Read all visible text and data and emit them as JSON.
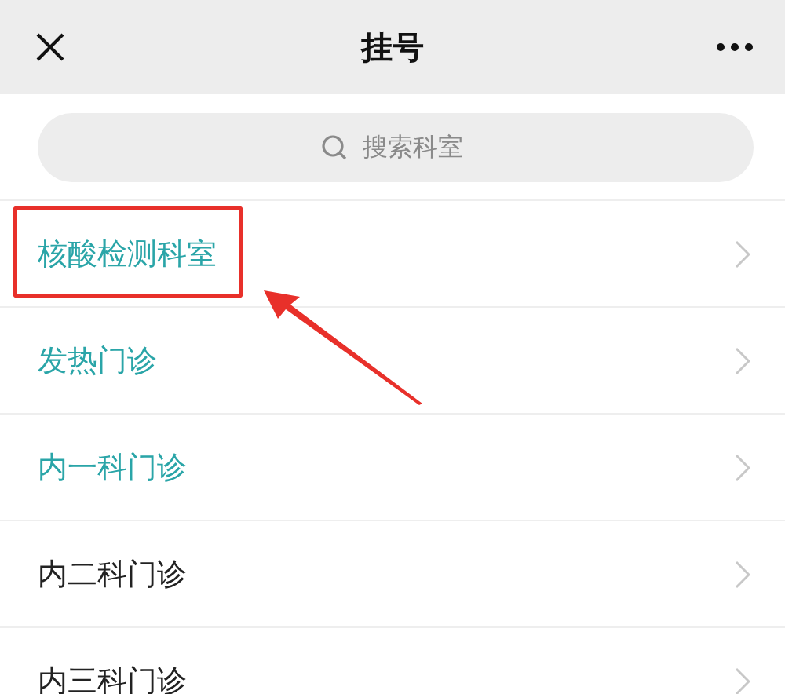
{
  "header": {
    "title": "挂号"
  },
  "search": {
    "placeholder": "搜索科室"
  },
  "departments": [
    {
      "name": "核酸检测科室",
      "color": "#2aa5a8",
      "marked": true
    },
    {
      "name": "发热门诊",
      "color": "#2aa5a8",
      "marked": false
    },
    {
      "name": "内一科门诊",
      "color": "#2aa5a8",
      "marked": false
    },
    {
      "name": "内二科门诊",
      "color": "#222222",
      "marked": false
    },
    {
      "name": "内三科门诊",
      "color": "#222222",
      "marked": false
    }
  ]
}
